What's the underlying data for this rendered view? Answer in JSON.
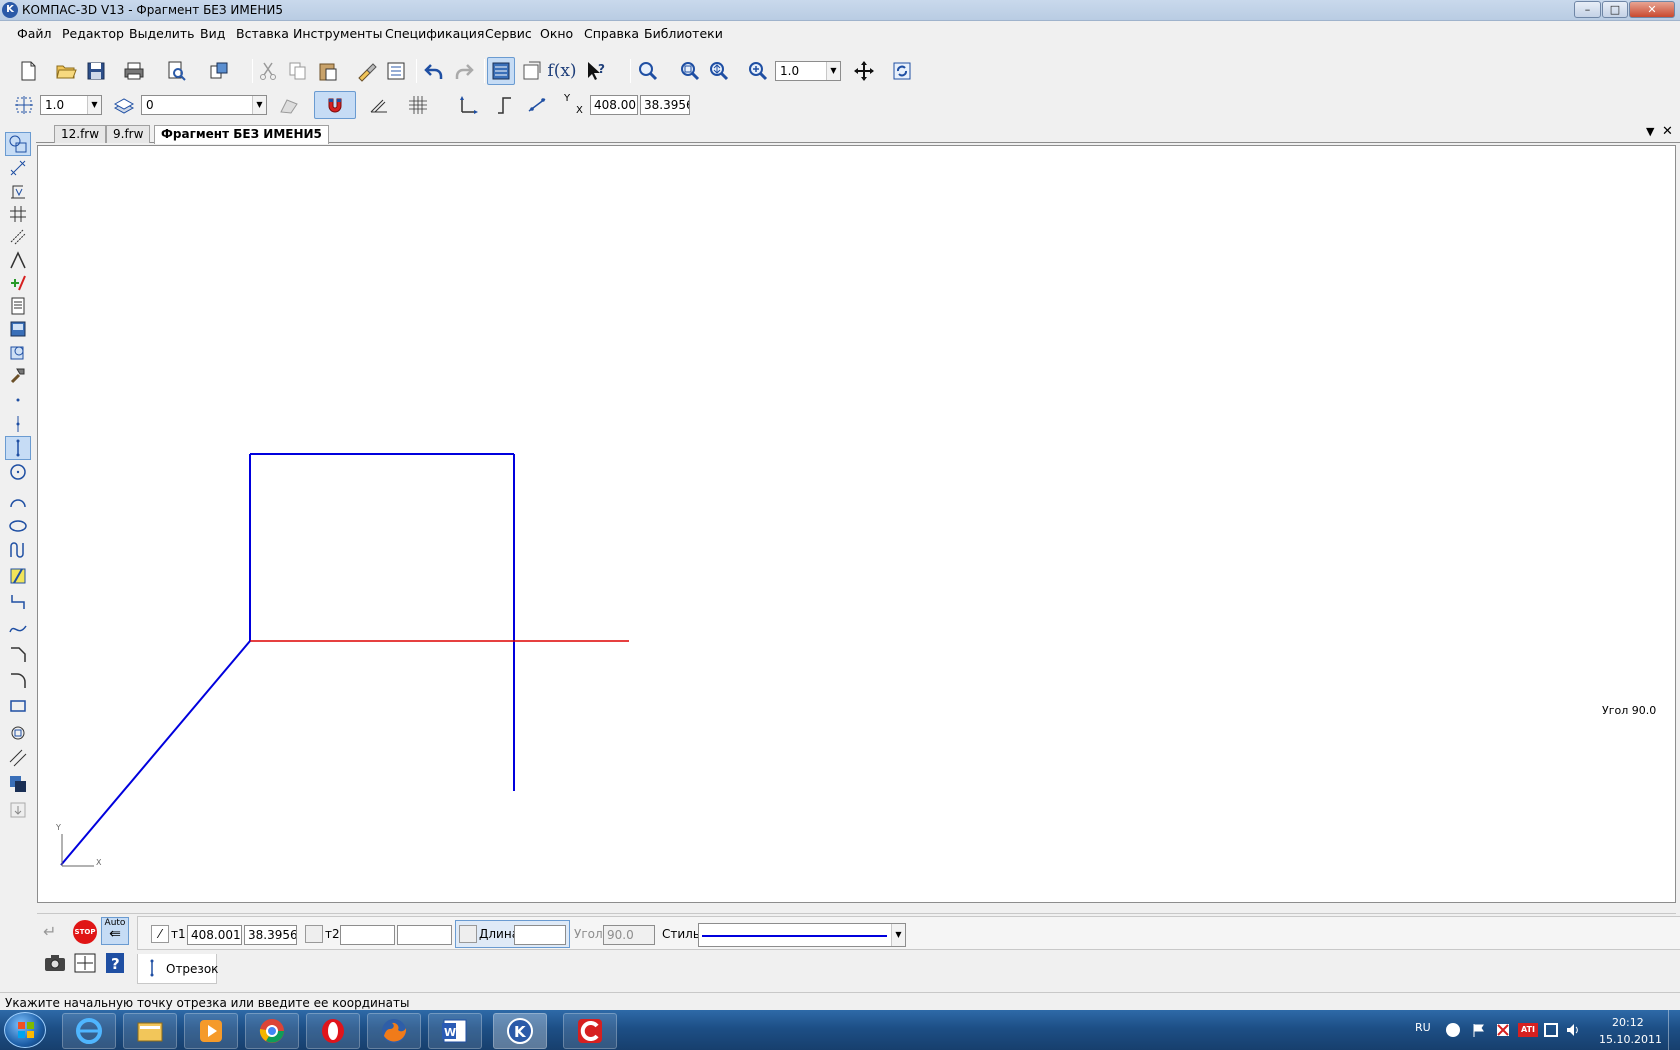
{
  "window": {
    "title": "КОМПАС-3D V13 - Фрагмент БЕЗ ИМЕНИ5"
  },
  "menu": [
    "Файл",
    "Редактор",
    "Выделить",
    "Вид",
    "Вставка",
    "Инструменты",
    "Спецификация",
    "Сервис",
    "Окно",
    "Справка",
    "Библиотеки"
  ],
  "toolbar": {
    "zoom_value": "1.0",
    "step_value": "1.0",
    "layer_value": "0",
    "coord_x_label": "Y",
    "coord_y_label": "X",
    "coord_x_value": "408.00",
    "coord_y_value": "38.3956",
    "formula_label": "f(x)"
  },
  "tabs": [
    "12.frw",
    "9.frw",
    "Фрагмент БЕЗ ИМЕНИ5"
  ],
  "canvas": {
    "angle_hint": "Угол 90.0",
    "axis_x": "X",
    "axis_y": "Y"
  },
  "property_panel": {
    "stop_label": "STOP",
    "auto_label": "Auto",
    "t1_label": "т1",
    "t1_x": "408.0010",
    "t1_y": "38.3956",
    "t2_label": "т2",
    "t2_x": "",
    "t2_y": "",
    "length_label": "Длина",
    "length_value": "",
    "angle_label": "Угол",
    "angle_value": "90.0",
    "style_label": "Стиль",
    "tab_label": "Отрезок"
  },
  "status": {
    "prompt": "Укажите начальную точку отрезка или введите ее координаты"
  },
  "taskbar": {
    "lang": "RU",
    "time": "20:12",
    "date": "15.10.2011"
  },
  "colors": {
    "line_main": "#0000dd",
    "line_aux": "#dd0000",
    "taskbar": "#1d4f86"
  }
}
